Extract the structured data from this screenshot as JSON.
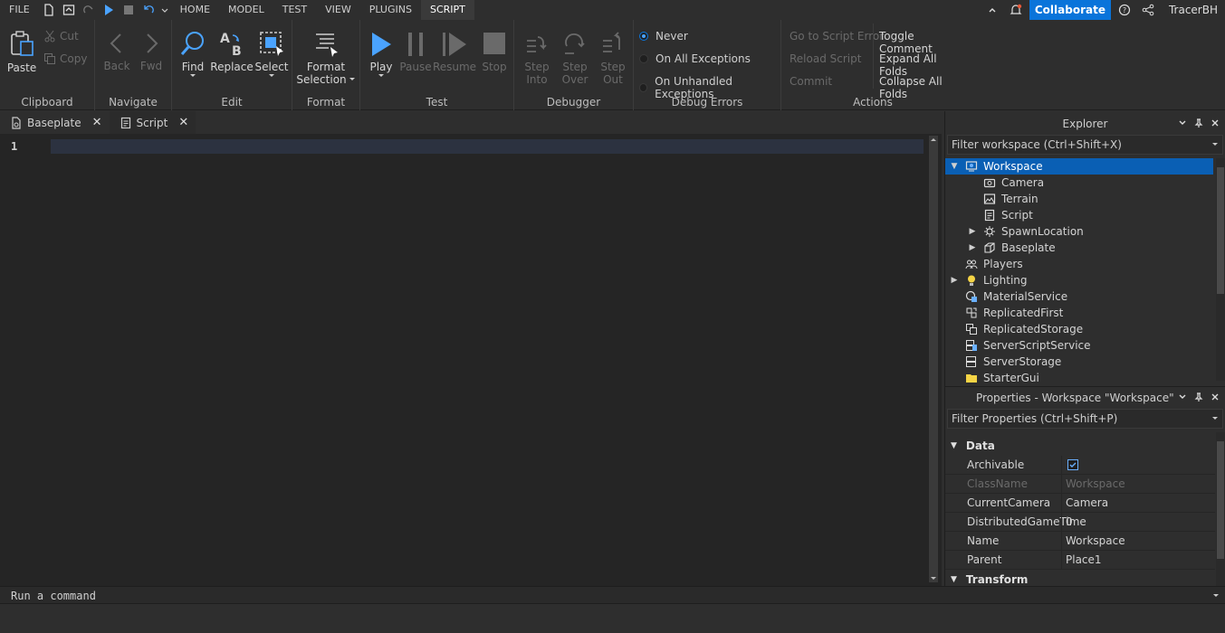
{
  "menubar": {
    "file": "FILE",
    "tabs": [
      "HOME",
      "MODEL",
      "TEST",
      "VIEW",
      "PLUGINS",
      "SCRIPT"
    ],
    "collaborate": "Collaborate",
    "user": "TracerBH"
  },
  "ribbon": {
    "clipboard": {
      "label": "Clipboard",
      "paste": "Paste",
      "cut": "Cut",
      "copy": "Copy"
    },
    "navigate": {
      "label": "Navigate",
      "back": "Back",
      "fwd": "Fwd"
    },
    "edit": {
      "label": "Edit",
      "find": "Find",
      "replace": "Replace",
      "select": "Select"
    },
    "format": {
      "label": "Format",
      "format_line1": "Format",
      "format_line2": "Selection"
    },
    "test": {
      "label": "Test",
      "play": "Play",
      "pause": "Pause",
      "resume": "Resume",
      "stop": "Stop"
    },
    "debugger": {
      "label": "Debugger",
      "step_into_1": "Step",
      "step_into_2": "Into",
      "step_over_1": "Step",
      "step_over_2": "Over",
      "step_out_1": "Step",
      "step_out_2": "Out"
    },
    "debug_errors": {
      "label": "Debug Errors",
      "options": [
        "Never",
        "On All Exceptions",
        "On Unhandled Exceptions"
      ],
      "selected": "Never"
    },
    "actions": {
      "label": "Actions",
      "left": [
        "Go to Script Error",
        "Reload Script",
        "Commit"
      ],
      "right": [
        "Toggle Comment",
        "Expand All Folds",
        "Collapse All Folds"
      ]
    }
  },
  "editor": {
    "tabs": [
      {
        "label": "Baseplate"
      },
      {
        "label": "Script"
      }
    ],
    "line_number": "1"
  },
  "explorer": {
    "title": "Explorer",
    "filter_placeholder": "Filter workspace (Ctrl+Shift+X)",
    "items": [
      {
        "label": "Workspace",
        "depth": 0,
        "expanded": true,
        "selected": true
      },
      {
        "label": "Camera",
        "depth": 1
      },
      {
        "label": "Terrain",
        "depth": 1
      },
      {
        "label": "Script",
        "depth": 1
      },
      {
        "label": "SpawnLocation",
        "depth": 1,
        "collapsed": true
      },
      {
        "label": "Baseplate",
        "depth": 1,
        "collapsed": true
      },
      {
        "label": "Players",
        "depth": 0
      },
      {
        "label": "Lighting",
        "depth": 0,
        "collapsed": true
      },
      {
        "label": "MaterialService",
        "depth": 0
      },
      {
        "label": "ReplicatedFirst",
        "depth": 0
      },
      {
        "label": "ReplicatedStorage",
        "depth": 0
      },
      {
        "label": "ServerScriptService",
        "depth": 0
      },
      {
        "label": "ServerStorage",
        "depth": 0
      },
      {
        "label": "StarterGui",
        "depth": 0
      }
    ]
  },
  "properties": {
    "title": "Properties - Workspace \"Workspace\"",
    "filter_placeholder": "Filter Properties (Ctrl+Shift+P)",
    "category_data": "Data",
    "rows": [
      {
        "name": "Archivable",
        "value": ""
      },
      {
        "name": "ClassName",
        "value": "Workspace"
      },
      {
        "name": "CurrentCamera",
        "value": "Camera"
      },
      {
        "name": "DistributedGameTime",
        "value": "0"
      },
      {
        "name": "Name",
        "value": "Workspace"
      },
      {
        "name": "Parent",
        "value": "Place1"
      }
    ],
    "category_transform": "Transform"
  },
  "command_bar": {
    "placeholder": "Run a command"
  },
  "colors": {
    "accent": "#0a74da",
    "selection": "#0a5fb4"
  }
}
